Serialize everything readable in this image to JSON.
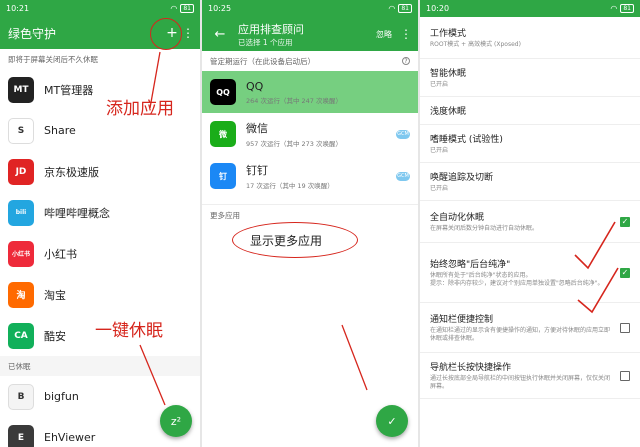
{
  "screen1": {
    "status_time": "10:21",
    "status_battery": "81",
    "title": "绿色守护",
    "add_icon": "+",
    "section_label": "即将于屏幕关闭后不久休眠",
    "apps": [
      {
        "name": "MT管理器",
        "icon_text": "MT",
        "color": "#222222"
      },
      {
        "name": "Share",
        "icon_text": "S",
        "color": "#ffffff"
      },
      {
        "name": "京东极速版",
        "icon_text": "JD",
        "color": "#e02424"
      },
      {
        "name": "哔哩哔哩概念",
        "icon_text": "bili",
        "color": "#23a6e0"
      },
      {
        "name": "小红书",
        "icon_text": "小红书",
        "color": "#ee2a3a"
      },
      {
        "name": "淘宝",
        "icon_text": "淘",
        "color": "#ff6a00"
      },
      {
        "name": "酷安",
        "icon_text": "CA",
        "color": "#11b05a"
      }
    ],
    "hibernated_label": "已休眠",
    "hibernated_apps": [
      {
        "name": "bigfun",
        "icon_text": "B",
        "color": "#f4f4f4"
      },
      {
        "name": "EhViewer",
        "icon_text": "E",
        "color": "#3a3a3a"
      }
    ],
    "note_add": "添加应用",
    "note_sleep": "一键休眠",
    "fab_label": "z²"
  },
  "screen2": {
    "status_time": "10:25",
    "status_battery": "81",
    "title": "应用排查顾问",
    "subtitle": "已选择 1 个应用",
    "ignore_label": "忽略",
    "section_label": "管定期运行（在此设备启动后）",
    "apps": [
      {
        "name": "QQ",
        "sub": "264 次运行（其中 247 次唤醒）",
        "icon_text": "QQ",
        "color": "#000000",
        "selected": true
      },
      {
        "name": "微信",
        "sub": "957 次运行（其中 273 次唤醒）",
        "icon_text": "微",
        "color": "#1aad19",
        "selected": false
      },
      {
        "name": "钉钉",
        "sub": "17 次运行（其中 19 次唤醒）",
        "icon_text": "钉",
        "color": "#1b88f5",
        "selected": false
      }
    ],
    "more_label": "更多应用",
    "note_more": "显示更多应用",
    "fab_label": "✓"
  },
  "screen3": {
    "status_time": "10:20",
    "status_battery": "81",
    "settings": [
      {
        "title": "工作模式",
        "desc": "ROOT模式 + 高效模式 (Xposed)",
        "check": null
      },
      {
        "title": "智能休眠",
        "desc": "已开启",
        "check": null
      },
      {
        "title": "浅度休眠",
        "desc": "",
        "check": null
      },
      {
        "title": "嗜睡模式 (试验性)",
        "desc": "已开启",
        "check": null
      },
      {
        "title": "唤醒追踪及切断",
        "desc": "已开启",
        "check": null
      },
      {
        "title": "全自动化休眠",
        "desc": "在屏幕关闭后数分钟自动进行自动休眠。",
        "check": true
      },
      {
        "title": "始终忽略\"后台纯净\"",
        "desc": "休眠所有处于\"后台纯净\"状态的应用。\n提示：除非内存较少，建议对个别应用单独设置\"忽略后台纯净\"。",
        "check": true
      },
      {
        "title": "通知栏便捷控制",
        "desc": "在通知栏通过的显示含有便捷操作的通知，方便对待休眠的应用立即休眠或排查休眠。",
        "check": false
      },
      {
        "title": "导航栏长按快捷操作",
        "desc": "通过长按底部全局导航栏的中间按钮执行休眠并关闭屏幕，仅仅关闭屏幕。",
        "check": false
      }
    ]
  },
  "colors": {
    "accent": "#2fa745",
    "annotation": "#d6261d",
    "selected_row": "#76cf80"
  }
}
